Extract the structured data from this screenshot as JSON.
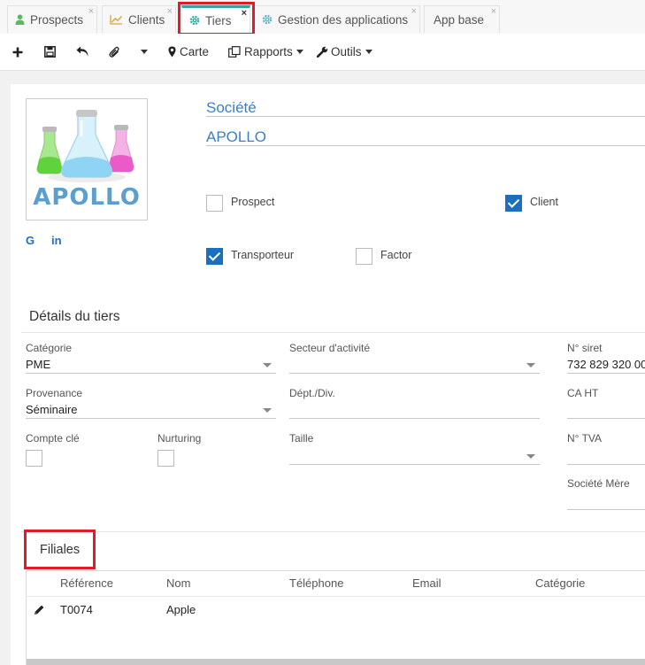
{
  "tabs": [
    {
      "label": "Prospects",
      "icon": "user-icon"
    },
    {
      "label": "Clients",
      "icon": "chart-line-icon"
    },
    {
      "label": "Tiers",
      "icon": "gear-icon"
    },
    {
      "label": "Gestion des applications",
      "icon": "gear-icon"
    },
    {
      "label": "App base",
      "icon": ""
    }
  ],
  "tab_close_glyph": "×",
  "toolbar": {
    "carte": "Carte",
    "rapports": "Rapports",
    "outils": "Outils"
  },
  "header": {
    "name_label": "Société",
    "name_value": "APOLLO",
    "logo_text": "APOLLO",
    "social_google": "G",
    "social_linkedin": "in"
  },
  "flags": {
    "prospect": {
      "label": "Prospect",
      "checked": false
    },
    "client": {
      "label": "Client",
      "checked": true
    },
    "transporteur": {
      "label": "Transporteur",
      "checked": true
    },
    "factor": {
      "label": "Factor",
      "checked": false
    }
  },
  "details": {
    "title": "Détails du tiers",
    "categorie_label": "Catégorie",
    "categorie_value": "PME",
    "secteur_label": "Secteur d'activité",
    "siret_label": "N° siret",
    "siret_value": "732 829 320 00",
    "provenance_label": "Provenance",
    "provenance_value": "Séminaire",
    "dept_label": "Dépt./Div.",
    "ca_label": "CA HT",
    "compte_cle_label": "Compte clé",
    "nurturing_label": "Nurturing",
    "taille_label": "Taille",
    "tva_label": "N° TVA",
    "societe_mere_label": "Société Mère"
  },
  "filiales": {
    "title": "Filiales",
    "columns": [
      "Référence",
      "Nom",
      "Téléphone",
      "Email",
      "Catégorie"
    ],
    "rows": [
      {
        "reference": "T0074",
        "nom": "Apple",
        "telephone": "",
        "email": "",
        "categorie": ""
      }
    ]
  },
  "colors": {
    "accent": "#1b6fc0",
    "active_tab": "#2ea7a0",
    "highlight": "#e01b2a"
  }
}
